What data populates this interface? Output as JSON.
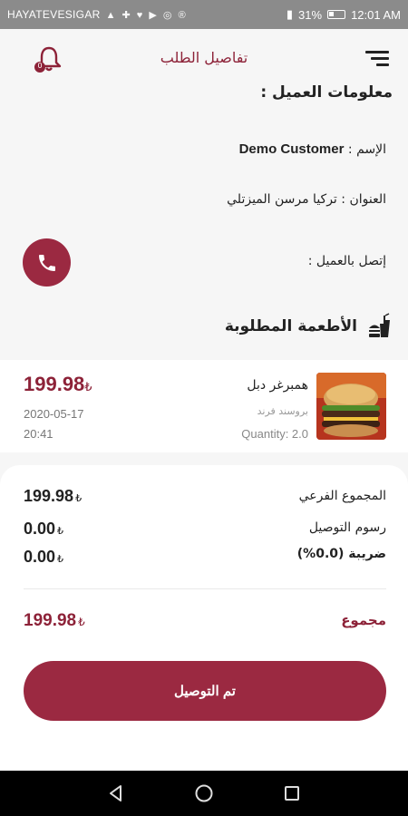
{
  "status_bar": {
    "carrier": "HAYATEVESIGAR",
    "icons": "▲ ✚ ♥ ▶ ◎ ®",
    "battery": "31%",
    "time": "12:01 AM"
  },
  "header": {
    "title": "تفاصيل الطلب",
    "notification_badge": "0"
  },
  "customer": {
    "section_title": "معلومات العميل :",
    "name_label": "الإسم :",
    "name_value": "Demo Customer",
    "address_label": "العنوان :",
    "address_value": "تركيا مرسن الميزتلي",
    "call_label": "إتصل بالعميل :"
  },
  "food": {
    "section_title": "الأطعمة المطلوبة",
    "items": [
      {
        "name": "همبرغر دبل",
        "restaurant": "بروسند فرند",
        "quantity": "Quantity: 2.0",
        "price": "199.98",
        "currency": "₺",
        "date": "2020-05-17",
        "time": "20:41"
      }
    ]
  },
  "summary": {
    "subtotal_label": "المجموع الفرعي",
    "subtotal_value": "199.98",
    "delivery_label": "رسوم التوصيل",
    "delivery_value": "0.00",
    "tax_label": "ضريبة (0.0%)",
    "tax_value": "0.00",
    "total_label": "مجموع",
    "total_value": "199.98",
    "currency": "₺"
  },
  "actions": {
    "delivered_button": "تم التوصيل"
  },
  "colors": {
    "accent": "#9b2941",
    "accent_text": "#8d2238"
  }
}
